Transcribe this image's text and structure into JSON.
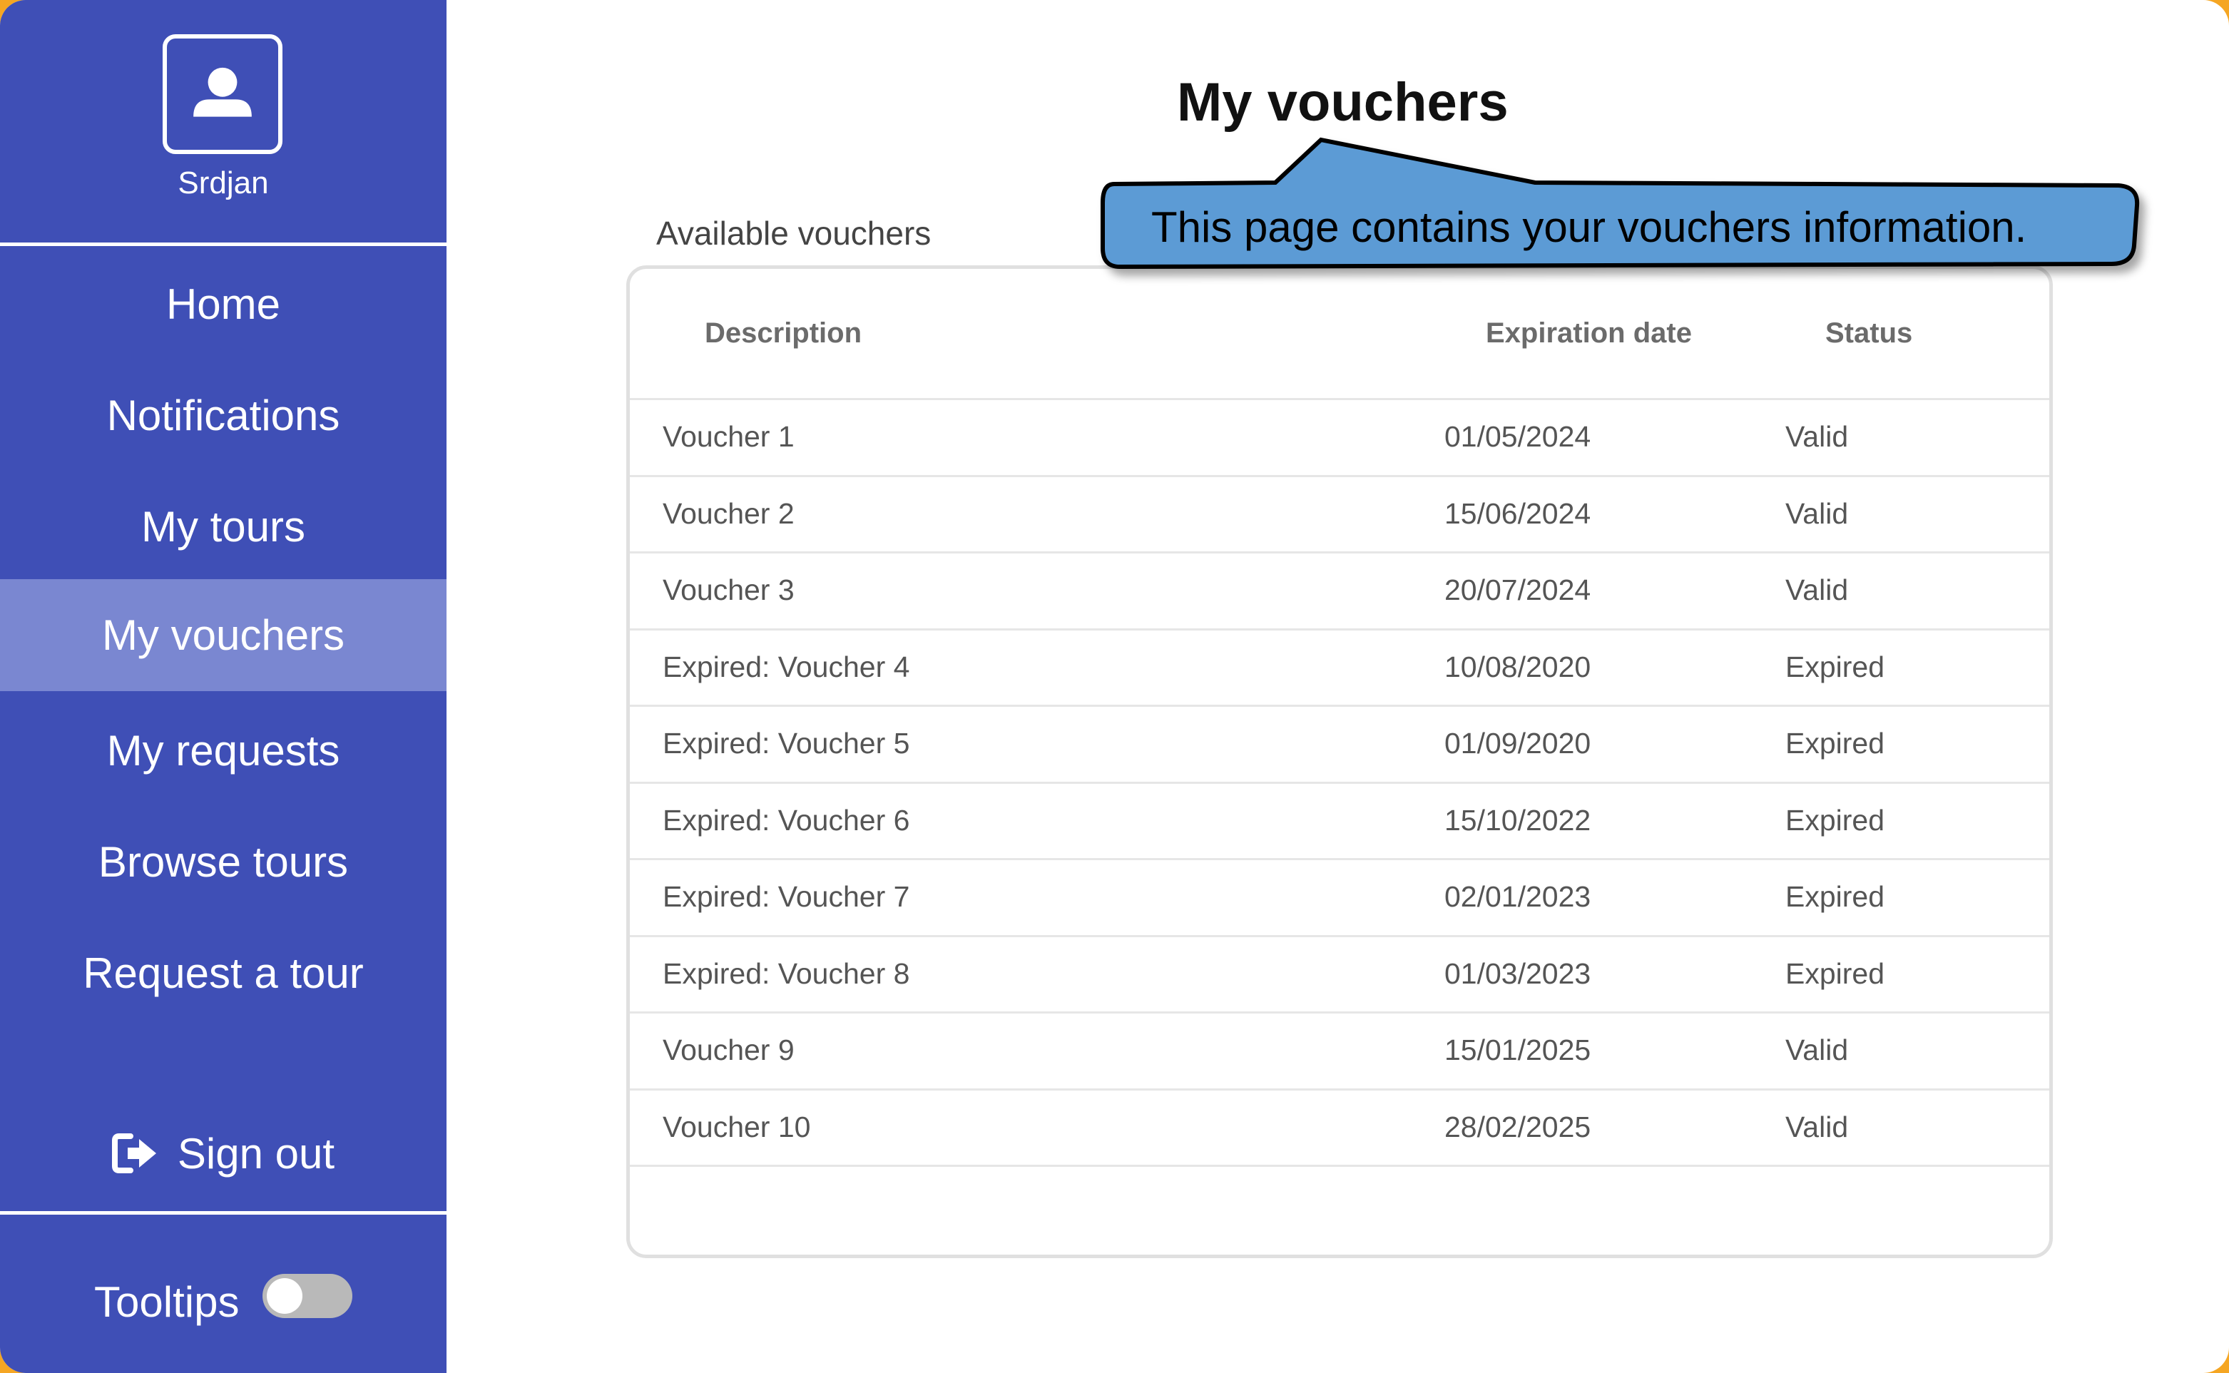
{
  "user": {
    "name": "Srdjan"
  },
  "sidebar": {
    "items": [
      {
        "label": "Home",
        "active": false
      },
      {
        "label": "Notifications",
        "active": false
      },
      {
        "label": "My tours",
        "active": false
      },
      {
        "label": "My vouchers",
        "active": true
      },
      {
        "label": "My requests",
        "active": false
      },
      {
        "label": "Browse tours",
        "active": false
      },
      {
        "label": "Request a tour",
        "active": false
      }
    ],
    "sign_out_label": "Sign out",
    "tooltips_label": "Tooltips",
    "tooltips_enabled": false
  },
  "page": {
    "title": "My vouchers",
    "section_label": "Available vouchers"
  },
  "tooltip": {
    "text": "This page contains your vouchers information."
  },
  "table": {
    "columns": [
      "Description",
      "Expiration date",
      "Status"
    ],
    "rows": [
      [
        "Voucher 1",
        "01/05/2024",
        "Valid"
      ],
      [
        "Voucher 2",
        "15/06/2024",
        "Valid"
      ],
      [
        "Voucher 3",
        "20/07/2024",
        "Valid"
      ],
      [
        "Expired: Voucher 4",
        "10/08/2020",
        "Expired"
      ],
      [
        "Expired: Voucher 5",
        "01/09/2020",
        "Expired"
      ],
      [
        "Expired: Voucher 6",
        "15/10/2022",
        "Expired"
      ],
      [
        "Expired: Voucher 7",
        "02/01/2023",
        "Expired"
      ],
      [
        "Expired: Voucher 8",
        "01/03/2023",
        "Expired"
      ],
      [
        "Voucher 9",
        "15/01/2025",
        "Valid"
      ],
      [
        "Voucher 10",
        "28/02/2025",
        "Valid"
      ]
    ]
  },
  "colors": {
    "sidebar_bg": "#3f4fb6",
    "sidebar_active": "#7a87d1",
    "callout_fill": "#5b9bd5",
    "frame_accent": "#f5a623"
  },
  "icons": {
    "avatar": "user-icon",
    "sign_out": "sign-out-icon"
  }
}
